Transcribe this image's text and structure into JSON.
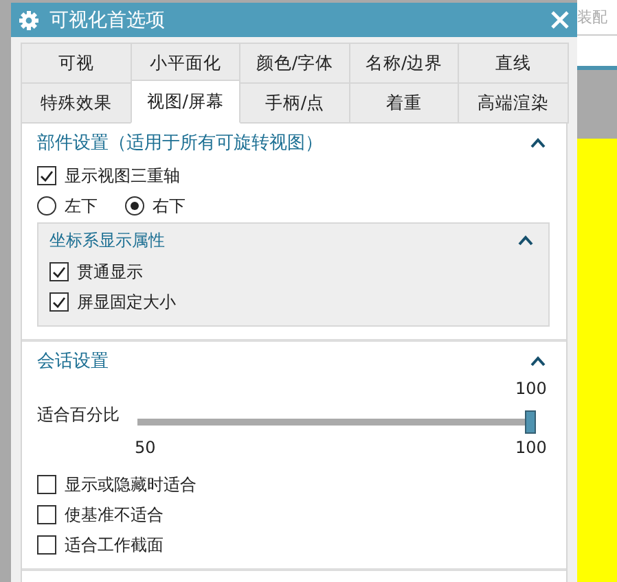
{
  "window": {
    "title": "可视化首选项"
  },
  "background": {
    "toolbar_label": "装配"
  },
  "tab_rows": [
    {
      "tabs": [
        {
          "label": "可视",
          "selected": false
        },
        {
          "label": "小平面化",
          "selected": false
        },
        {
          "label": "颜色/字体",
          "selected": false
        },
        {
          "label": "名称/边界",
          "selected": false
        },
        {
          "label": "直线",
          "selected": false
        }
      ]
    },
    {
      "tabs": [
        {
          "label": "特殊效果",
          "selected": false
        },
        {
          "label": "视图/屏幕",
          "selected": true
        },
        {
          "label": "手柄/点",
          "selected": false
        },
        {
          "label": "着重",
          "selected": false
        },
        {
          "label": "高端渲染",
          "selected": false
        }
      ]
    }
  ],
  "sections": [
    {
      "title": "部件设置（适用于所有可旋转视图）",
      "expanded": true,
      "items": [
        {
          "kind": "checkbox",
          "label": "显示视图三重轴",
          "checked": true
        },
        {
          "kind": "radio_group",
          "options": [
            {
              "label": "左下",
              "selected": false
            },
            {
              "label": "右下",
              "selected": true
            }
          ]
        },
        {
          "kind": "subsection",
          "title": "坐标系显示属性",
          "expanded": true,
          "items": [
            {
              "kind": "checkbox",
              "label": "贯通显示",
              "checked": true
            },
            {
              "kind": "checkbox",
              "label": "屏显固定大小",
              "checked": true
            }
          ]
        }
      ]
    },
    {
      "title": "会话设置",
      "expanded": true,
      "items": [
        {
          "kind": "slider",
          "label": "适合百分比",
          "value": "100",
          "min_label": "50",
          "max_label": "100",
          "level": 1
        },
        {
          "kind": "checkbox",
          "label": "显示或隐藏时适合",
          "checked": false
        },
        {
          "kind": "checkbox",
          "label": "使基准不适合",
          "checked": false
        },
        {
          "kind": "checkbox",
          "label": "适合工作截面",
          "checked": false
        }
      ]
    }
  ]
}
